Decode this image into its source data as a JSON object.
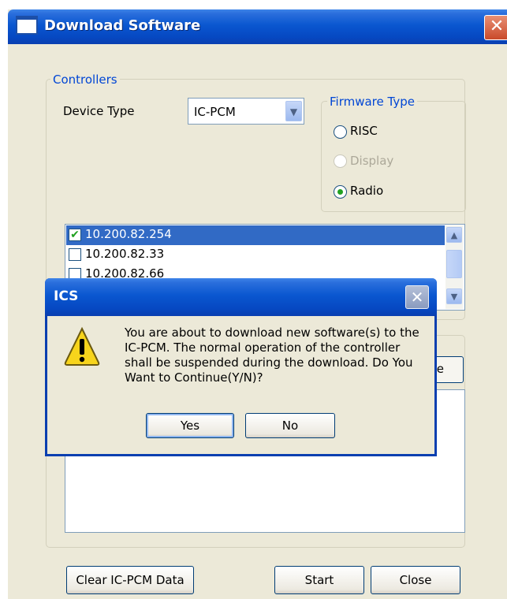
{
  "main_window": {
    "title": "Download Software",
    "close_glyph": "✕"
  },
  "controllers": {
    "legend": "Controllers",
    "device_type_label": "Device Type",
    "device_type_value": "IC-PCM",
    "firmware": {
      "legend": "Firmware Type",
      "options": [
        {
          "label": "RISC",
          "selected": false,
          "enabled": true
        },
        {
          "label": "Display",
          "selected": false,
          "enabled": false
        },
        {
          "label": "Radio",
          "selected": true,
          "enabled": true
        }
      ]
    },
    "ip_list": [
      {
        "ip": "10.200.82.254",
        "checked": true,
        "selected": true
      },
      {
        "ip": "10.200.82.33",
        "checked": false,
        "selected": false
      },
      {
        "ip": "10.200.82.66",
        "checked": false,
        "selected": false
      }
    ]
  },
  "lower": {
    "partial_button_label": "e"
  },
  "buttons": {
    "clear": "Clear IC-PCM Data",
    "start": "Start",
    "close": "Close"
  },
  "dialog": {
    "title": "ICS",
    "close_glyph": "✕",
    "message_lines": [
      "You are about to download new software(s) to the",
      "IC-PCM. The normal operation of the controller",
      "shall be suspended during the download. Do You",
      "Want to Continue(Y/N)?"
    ],
    "yes": "Yes",
    "no": "No"
  },
  "colors": {
    "titlebar": "#0a57d0",
    "dialog_face": "#ece9d8",
    "legend_text": "#0046d5",
    "selection": "#316ac5"
  },
  "icons": {
    "dialog": "warning-icon",
    "window": "window-icon"
  }
}
